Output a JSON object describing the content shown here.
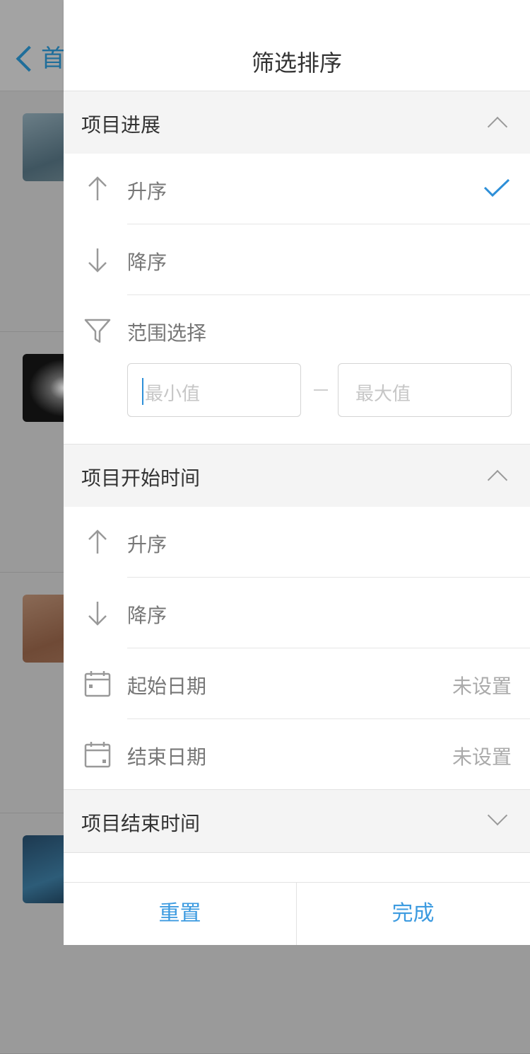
{
  "background": {
    "back_label": "首"
  },
  "drawer": {
    "title": "筛选排序",
    "sections": [
      {
        "title": "项目进展",
        "expanded": true,
        "options": [
          {
            "label": "升序",
            "icon": "arrow-up-icon",
            "selected": true
          },
          {
            "label": "降序",
            "icon": "arrow-down-icon",
            "selected": false
          }
        ],
        "range": {
          "label": "范围选择",
          "icon": "filter-icon",
          "min_placeholder": "最小值",
          "max_placeholder": "最大值"
        }
      },
      {
        "title": "项目开始时间",
        "expanded": true,
        "options": [
          {
            "label": "升序",
            "icon": "arrow-up-icon"
          },
          {
            "label": "降序",
            "icon": "arrow-down-icon"
          }
        ],
        "dates": [
          {
            "label": "起始日期",
            "value": "未设置",
            "icon": "calendar-start-icon"
          },
          {
            "label": "结束日期",
            "value": "未设置",
            "icon": "calendar-end-icon"
          }
        ]
      },
      {
        "title": "项目结束时间",
        "expanded": false
      }
    ],
    "footer": {
      "reset_label": "重置",
      "done_label": "完成"
    }
  },
  "colors": {
    "accent": "#3d9be0",
    "check": "#2d8fd8"
  }
}
